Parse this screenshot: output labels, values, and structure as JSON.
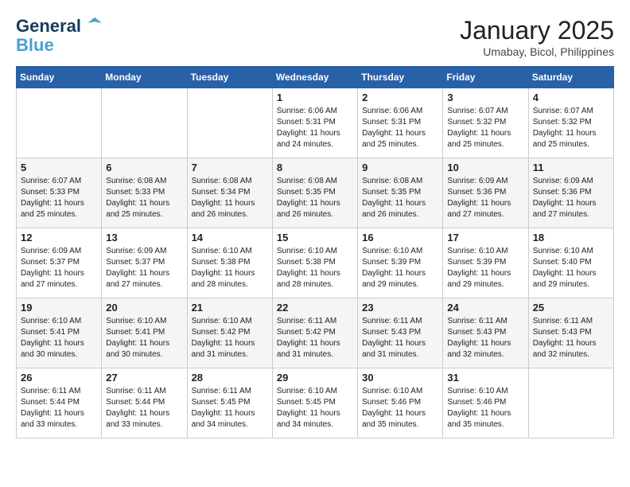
{
  "logo": {
    "line1": "General",
    "line2": "Blue"
  },
  "title": "January 2025",
  "subtitle": "Umabay, Bicol, Philippines",
  "weekdays": [
    "Sunday",
    "Monday",
    "Tuesday",
    "Wednesday",
    "Thursday",
    "Friday",
    "Saturday"
  ],
  "weeks": [
    [
      {
        "day": "",
        "info": ""
      },
      {
        "day": "",
        "info": ""
      },
      {
        "day": "",
        "info": ""
      },
      {
        "day": "1",
        "info": "Sunrise: 6:06 AM\nSunset: 5:31 PM\nDaylight: 11 hours\nand 24 minutes."
      },
      {
        "day": "2",
        "info": "Sunrise: 6:06 AM\nSunset: 5:31 PM\nDaylight: 11 hours\nand 25 minutes."
      },
      {
        "day": "3",
        "info": "Sunrise: 6:07 AM\nSunset: 5:32 PM\nDaylight: 11 hours\nand 25 minutes."
      },
      {
        "day": "4",
        "info": "Sunrise: 6:07 AM\nSunset: 5:32 PM\nDaylight: 11 hours\nand 25 minutes."
      }
    ],
    [
      {
        "day": "5",
        "info": "Sunrise: 6:07 AM\nSunset: 5:33 PM\nDaylight: 11 hours\nand 25 minutes."
      },
      {
        "day": "6",
        "info": "Sunrise: 6:08 AM\nSunset: 5:33 PM\nDaylight: 11 hours\nand 25 minutes."
      },
      {
        "day": "7",
        "info": "Sunrise: 6:08 AM\nSunset: 5:34 PM\nDaylight: 11 hours\nand 26 minutes."
      },
      {
        "day": "8",
        "info": "Sunrise: 6:08 AM\nSunset: 5:35 PM\nDaylight: 11 hours\nand 26 minutes."
      },
      {
        "day": "9",
        "info": "Sunrise: 6:08 AM\nSunset: 5:35 PM\nDaylight: 11 hours\nand 26 minutes."
      },
      {
        "day": "10",
        "info": "Sunrise: 6:09 AM\nSunset: 5:36 PM\nDaylight: 11 hours\nand 27 minutes."
      },
      {
        "day": "11",
        "info": "Sunrise: 6:09 AM\nSunset: 5:36 PM\nDaylight: 11 hours\nand 27 minutes."
      }
    ],
    [
      {
        "day": "12",
        "info": "Sunrise: 6:09 AM\nSunset: 5:37 PM\nDaylight: 11 hours\nand 27 minutes."
      },
      {
        "day": "13",
        "info": "Sunrise: 6:09 AM\nSunset: 5:37 PM\nDaylight: 11 hours\nand 27 minutes."
      },
      {
        "day": "14",
        "info": "Sunrise: 6:10 AM\nSunset: 5:38 PM\nDaylight: 11 hours\nand 28 minutes."
      },
      {
        "day": "15",
        "info": "Sunrise: 6:10 AM\nSunset: 5:38 PM\nDaylight: 11 hours\nand 28 minutes."
      },
      {
        "day": "16",
        "info": "Sunrise: 6:10 AM\nSunset: 5:39 PM\nDaylight: 11 hours\nand 29 minutes."
      },
      {
        "day": "17",
        "info": "Sunrise: 6:10 AM\nSunset: 5:39 PM\nDaylight: 11 hours\nand 29 minutes."
      },
      {
        "day": "18",
        "info": "Sunrise: 6:10 AM\nSunset: 5:40 PM\nDaylight: 11 hours\nand 29 minutes."
      }
    ],
    [
      {
        "day": "19",
        "info": "Sunrise: 6:10 AM\nSunset: 5:41 PM\nDaylight: 11 hours\nand 30 minutes."
      },
      {
        "day": "20",
        "info": "Sunrise: 6:10 AM\nSunset: 5:41 PM\nDaylight: 11 hours\nand 30 minutes."
      },
      {
        "day": "21",
        "info": "Sunrise: 6:10 AM\nSunset: 5:42 PM\nDaylight: 11 hours\nand 31 minutes."
      },
      {
        "day": "22",
        "info": "Sunrise: 6:11 AM\nSunset: 5:42 PM\nDaylight: 11 hours\nand 31 minutes."
      },
      {
        "day": "23",
        "info": "Sunrise: 6:11 AM\nSunset: 5:43 PM\nDaylight: 11 hours\nand 31 minutes."
      },
      {
        "day": "24",
        "info": "Sunrise: 6:11 AM\nSunset: 5:43 PM\nDaylight: 11 hours\nand 32 minutes."
      },
      {
        "day": "25",
        "info": "Sunrise: 6:11 AM\nSunset: 5:43 PM\nDaylight: 11 hours\nand 32 minutes."
      }
    ],
    [
      {
        "day": "26",
        "info": "Sunrise: 6:11 AM\nSunset: 5:44 PM\nDaylight: 11 hours\nand 33 minutes."
      },
      {
        "day": "27",
        "info": "Sunrise: 6:11 AM\nSunset: 5:44 PM\nDaylight: 11 hours\nand 33 minutes."
      },
      {
        "day": "28",
        "info": "Sunrise: 6:11 AM\nSunset: 5:45 PM\nDaylight: 11 hours\nand 34 minutes."
      },
      {
        "day": "29",
        "info": "Sunrise: 6:10 AM\nSunset: 5:45 PM\nDaylight: 11 hours\nand 34 minutes."
      },
      {
        "day": "30",
        "info": "Sunrise: 6:10 AM\nSunset: 5:46 PM\nDaylight: 11 hours\nand 35 minutes."
      },
      {
        "day": "31",
        "info": "Sunrise: 6:10 AM\nSunset: 5:46 PM\nDaylight: 11 hours\nand 35 minutes."
      },
      {
        "day": "",
        "info": ""
      }
    ]
  ]
}
